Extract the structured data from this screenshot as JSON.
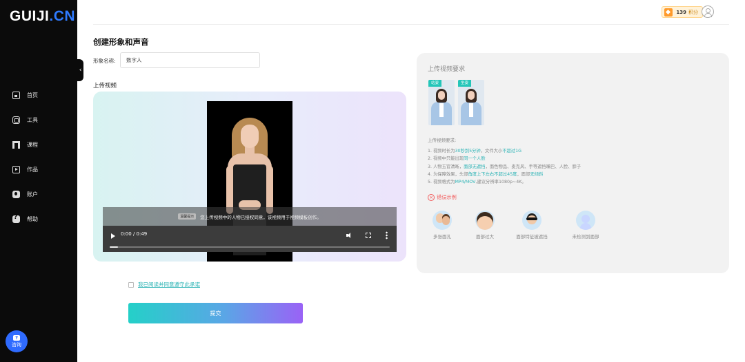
{
  "sidebar": {
    "logo_main": "GUIJI",
    "logo_dot": ".CN",
    "collapse_glyph": "‹",
    "items": [
      {
        "label": "首页",
        "icon": "home-icon"
      },
      {
        "label": "工具",
        "icon": "tools-icon"
      },
      {
        "label": "课程",
        "icon": "course-icon"
      },
      {
        "label": "作品",
        "icon": "works-icon"
      },
      {
        "label": "账户",
        "icon": "account-icon"
      },
      {
        "label": "帮助",
        "icon": "help-icon"
      }
    ],
    "consult_label": "咨询"
  },
  "header": {
    "points_value": "139",
    "points_unit": "积分"
  },
  "main": {
    "title": "创建形象和声音",
    "name_label": "形象名称:",
    "name_value": "数字人",
    "upload_label": "上传视频",
    "video": {
      "notice_tag": "温馨提示",
      "notice_text": "您上传视频中的人物已授权同意，该视频用于视频模板创作。",
      "time": "0:00 / 0:49",
      "progress": 0.03
    },
    "agree_text": "我已阅读并同意遵守此承诺",
    "submit_label": "提交"
  },
  "requirements": {
    "title": "上传视频要求",
    "samples": [
      {
        "badge": "站姿"
      },
      {
        "badge": "坐姿"
      }
    ],
    "subtitle": "上传视频要求:",
    "rules": [
      {
        "pre": "1. 视频时长为",
        "hl": "30秒到5分钟",
        "mid": "，文件大小",
        "hl2": "不超过1G",
        "post": ""
      },
      {
        "pre": "2. 视频中只能出现",
        "hl": "同一个人脸",
        "mid": "",
        "hl2": "",
        "post": ""
      },
      {
        "pre": "3. 人物五官清晰，",
        "hl": "面部无遮挡",
        "mid": "，面色物品、麦克风、手等遮挡嘴巴、人脸、脖子",
        "hl2": "",
        "post": ""
      },
      {
        "pre": "4. 为保障效果，头部",
        "hl": "角度上下左右不超过45度",
        "mid": "，面部",
        "hl2": "无倾斜",
        "post": ""
      },
      {
        "pre": "5. 视频格式为",
        "hl": "MP4/MOV",
        "mid": ",建议分辨率1080p~4K。",
        "hl2": "",
        "post": ""
      }
    ],
    "wrong_title": "错误示例",
    "examples": [
      {
        "label": "多张面孔"
      },
      {
        "label": "面部过大"
      },
      {
        "label": "面部特征被遮挡"
      },
      {
        "label": "未检测到面部"
      }
    ]
  },
  "colors": {
    "accent": "#2bb3b5",
    "brand_blue": "#2f7bff",
    "error": "#f25a5a"
  }
}
